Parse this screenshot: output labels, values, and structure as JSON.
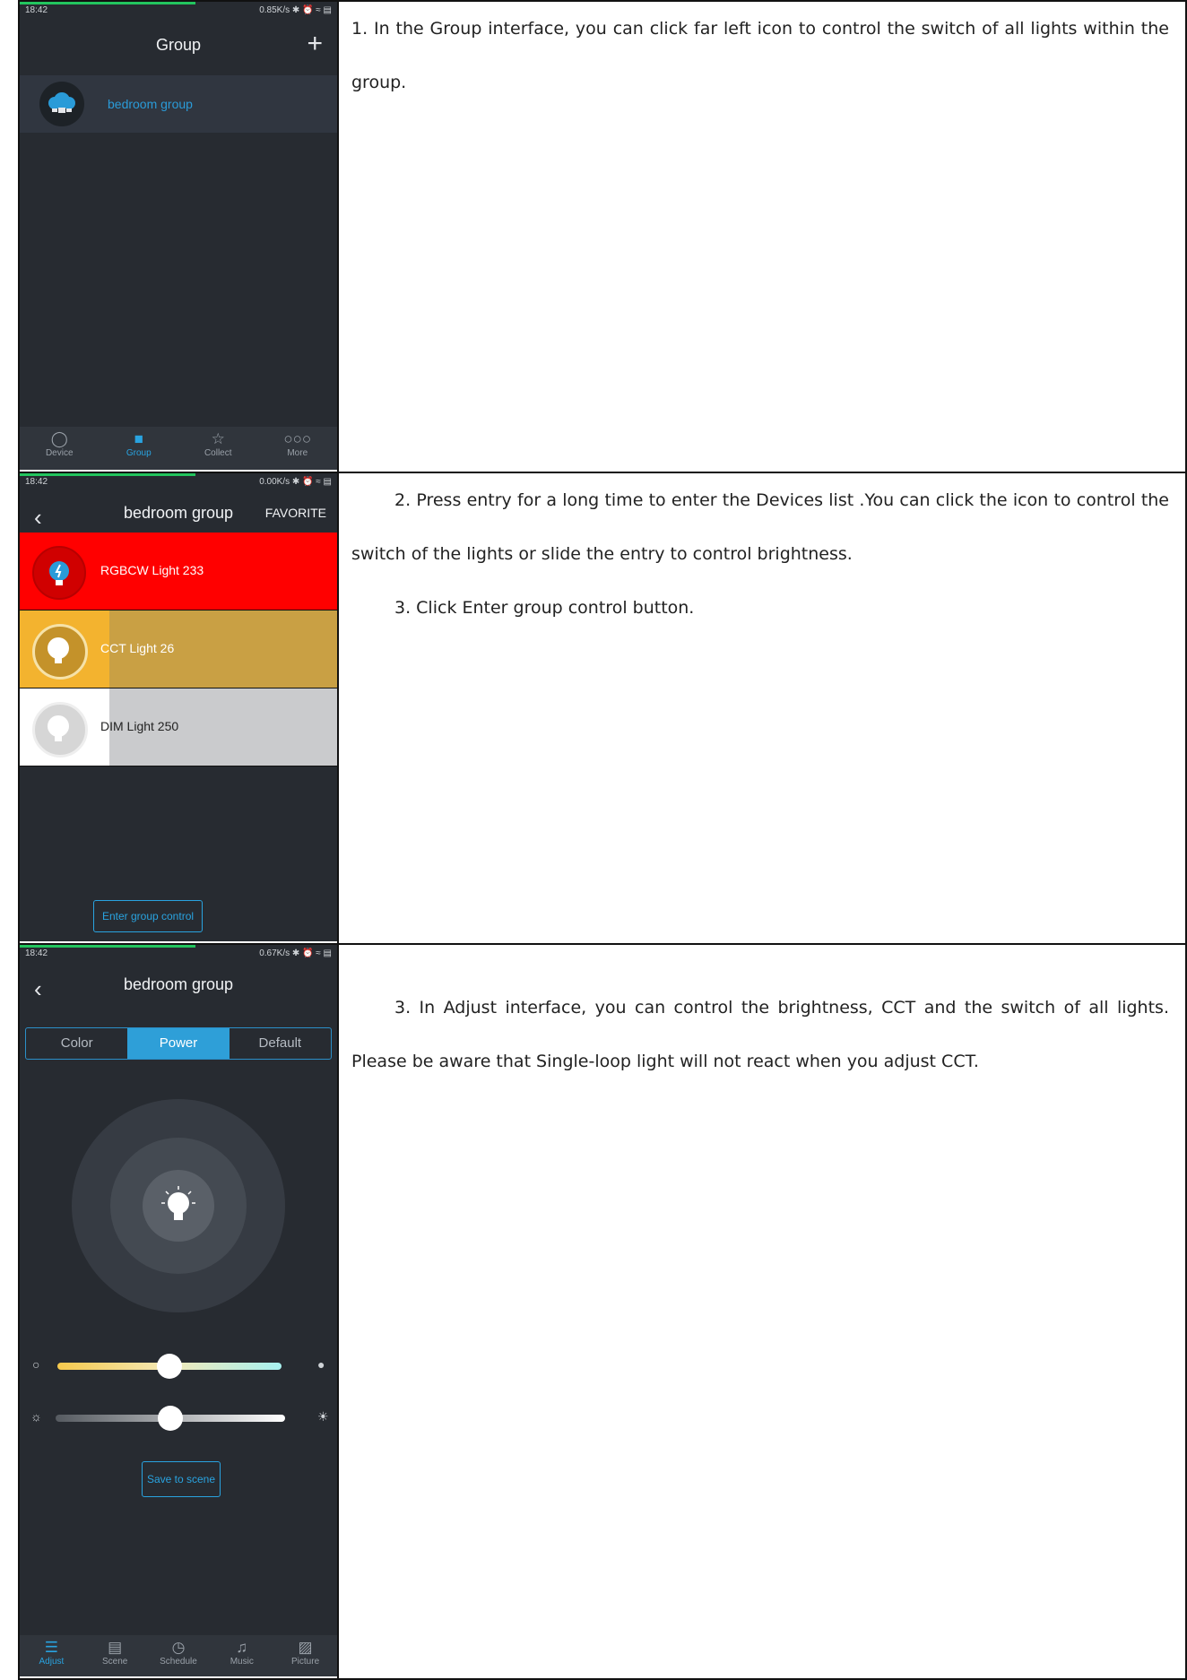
{
  "rows": [
    {
      "screen": {
        "status": {
          "time": "18:42",
          "net": "0.85K/s ✱ ⏰ ≈ ▤"
        },
        "title": "Group",
        "plus": "+",
        "group_label": "bedroom group",
        "nav": [
          {
            "label": "Device",
            "icon": "lightbulb-icon",
            "glyph": "◯"
          },
          {
            "label": "Group",
            "icon": "grid-icon",
            "glyph": "■"
          },
          {
            "label": "Collect",
            "icon": "star-icon",
            "glyph": "☆"
          },
          {
            "label": "More",
            "icon": "more-icon",
            "glyph": "○○○"
          }
        ],
        "active_nav": "Group"
      },
      "paragraphs": [
        "1. In the Group interface, you can click far left icon to control the switch of all lights within the group."
      ]
    },
    {
      "screen": {
        "status": {
          "time": "18:42",
          "net": "0.00K/s ✱ ⏰ ≈ ▤"
        },
        "back": "‹",
        "title": "bedroom group",
        "favorite": "FAVORITE",
        "devices": [
          {
            "name": "RGBCW Light 233",
            "color": "#ff0000",
            "brightness": 1.0
          },
          {
            "name": "CCT Light 26",
            "color": "#c9a044",
            "brightness": 0.7
          },
          {
            "name": "DIM Light 250",
            "color": "#cacbcd",
            "brightness": 0.7
          }
        ],
        "enter_button": "Enter group control"
      },
      "paragraphs": [
        "2. Press entry for a long time to enter the Devices list .You can click the icon to control the switch of the lights or slide the entry to control brightness.",
        "3. Click Enter group control button."
      ]
    },
    {
      "screen": {
        "status": {
          "time": "18:42",
          "net": "0.67K/s ✱ ⏰ ≈ ▤"
        },
        "back": "‹",
        "title": "bedroom group",
        "tabs": [
          "Color",
          "Power",
          "Default"
        ],
        "active_tab": "Power",
        "cct_level": 0.5,
        "brightness_level": 0.5,
        "save_button": "Save to scene",
        "nav": [
          {
            "label": "Adjust",
            "icon": "sliders-icon",
            "glyph": "☰"
          },
          {
            "label": "Scene",
            "icon": "clapper-icon",
            "glyph": "▤"
          },
          {
            "label": "Schedule",
            "icon": "clock-icon",
            "glyph": "◷"
          },
          {
            "label": "Music",
            "icon": "music-note-icon",
            "glyph": "♫"
          },
          {
            "label": "Picture",
            "icon": "picture-icon",
            "glyph": "▨"
          }
        ],
        "active_nav": "Adjust"
      },
      "paragraphs": [
        "3. In Adjust interface, you can control the brightness, CCT and the switch of all lights. Please be aware that Single-loop light will not react when you adjust CCT."
      ]
    }
  ]
}
